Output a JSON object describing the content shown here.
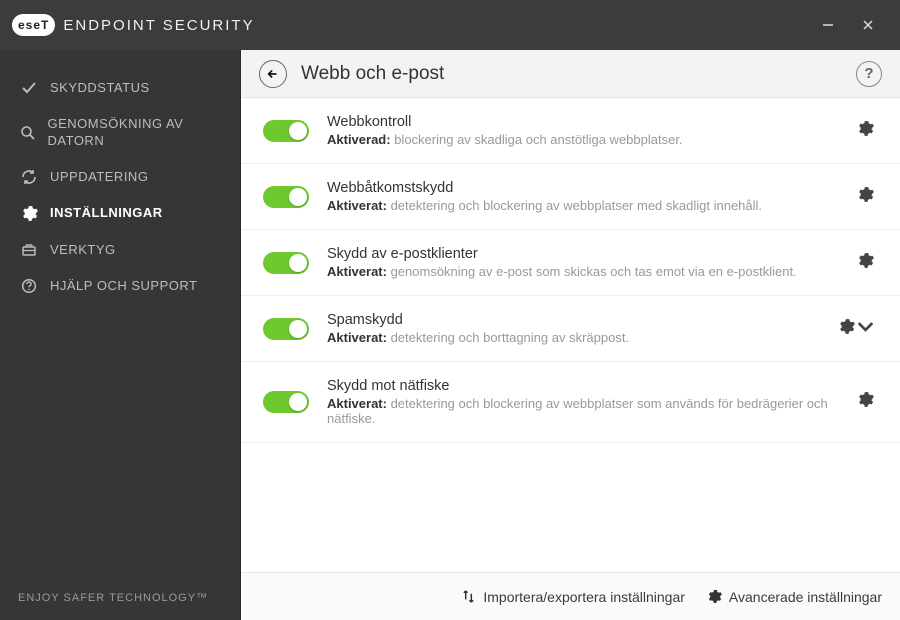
{
  "brand": {
    "badge": "eseT",
    "product": "ENDPOINT SECURITY"
  },
  "window_controls": {
    "minimize": "minimize",
    "close": "close"
  },
  "sidebar": {
    "items": [
      {
        "label": "SKYDDSTATUS",
        "icon": "check"
      },
      {
        "label": "GENOMSÖKNING AV DATORN",
        "icon": "search"
      },
      {
        "label": "UPPDATERING",
        "icon": "refresh"
      },
      {
        "label": "INSTÄLLNINGAR",
        "icon": "gear",
        "active": true
      },
      {
        "label": "VERKTYG",
        "icon": "toolbox"
      },
      {
        "label": "HJÄLP OCH SUPPORT",
        "icon": "help"
      }
    ],
    "tagline": "ENJOY SAFER TECHNOLOGY™"
  },
  "header": {
    "title": "Webb och e-post",
    "help_label": "?"
  },
  "settings": [
    {
      "title": "Webbkontroll",
      "status": "Aktiverad:",
      "detail": "blockering av skadliga och anstötliga webbplatser.",
      "on": true,
      "has_menu": false
    },
    {
      "title": "Webbåtkomstskydd",
      "status": "Aktiverat:",
      "detail": "detektering och blockering av webbplatser med skadligt innehåll.",
      "on": true,
      "has_menu": false
    },
    {
      "title": "Skydd av e-postklienter",
      "status": "Aktiverat:",
      "detail": "genomsökning av e-post som skickas och tas emot via en e-postklient.",
      "on": true,
      "has_menu": false
    },
    {
      "title": "Spamskydd",
      "status": "Aktiverat:",
      "detail": "detektering och borttagning av skräppost.",
      "on": true,
      "has_menu": true
    },
    {
      "title": "Skydd mot nätfiske",
      "status": "Aktiverat:",
      "detail": "detektering och blockering av webbplatser som används för bedrägerier och nätfiske.",
      "on": true,
      "has_menu": false
    }
  ],
  "footer": {
    "import_export": "Importera/exportera inställningar",
    "advanced": "Avancerade inställningar"
  }
}
